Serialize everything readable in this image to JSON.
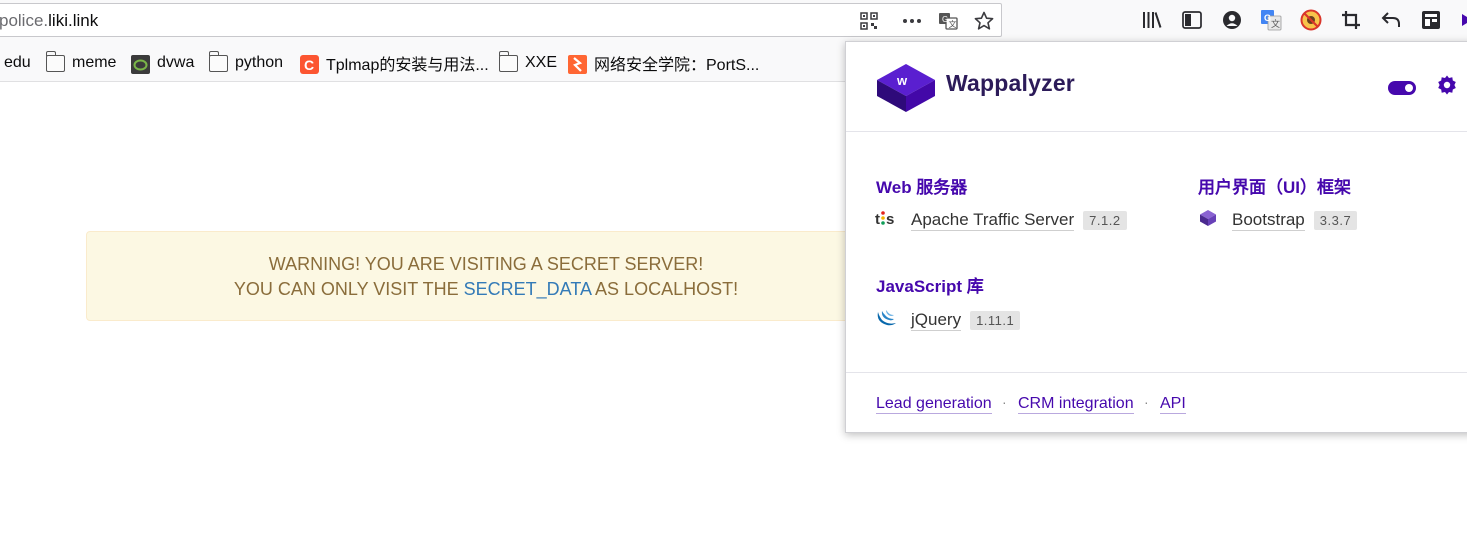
{
  "browser": {
    "url_prefix": "police.",
    "url_host": "liki.link",
    "icons": [
      "qrcode-icon",
      "more-icon",
      "translate-icon",
      "bookmark-star-icon",
      "library-icon",
      "sidebar-icon",
      "account-icon",
      "google-translate-icon",
      "blocker-icon",
      "crop-icon",
      "back-icon",
      "container-icon",
      "wappalyzer-icon"
    ]
  },
  "bookmarks": [
    {
      "label": "edu",
      "icon": "folder-icon"
    },
    {
      "label": "meme",
      "icon": "folder-icon"
    },
    {
      "label": "dvwa",
      "icon": "dvwa-icon"
    },
    {
      "label": "python",
      "icon": "folder-icon"
    },
    {
      "label": "Tplmap的安装与用法...",
      "icon": "csdn-icon"
    },
    {
      "label": "XXE",
      "icon": "folder-icon"
    },
    {
      "label": "网络安全学院：PortS...",
      "icon": "portswigger-icon"
    }
  ],
  "page": {
    "warning_line1": "WARNING! YOU ARE VISITING A SECRET SERVER!",
    "warning_line2_pre": "YOU CAN ONLY VISIT THE",
    "warning_link": "SECRET_DATA",
    "warning_line2_post": "AS LOCALHOST!"
  },
  "wappalyzer": {
    "brand": "Wappalyzer",
    "accent": "#4608ad",
    "categories": [
      {
        "title": "Web 服务器",
        "tech": [
          {
            "name": "Apache Traffic Server",
            "version": "7.1.2",
            "icon": "apache-traffic-server-icon"
          }
        ]
      },
      {
        "title": "用户界面（UI）框架",
        "tech": [
          {
            "name": "Bootstrap",
            "version": "3.3.7",
            "icon": "bootstrap-icon"
          }
        ]
      },
      {
        "title": "JavaScript 库",
        "tech": [
          {
            "name": "jQuery",
            "version": "1.11.1",
            "icon": "jquery-icon"
          }
        ]
      }
    ],
    "footer_links": [
      "Lead generation",
      "CRM integration",
      "API"
    ],
    "footer_separator": "·"
  }
}
